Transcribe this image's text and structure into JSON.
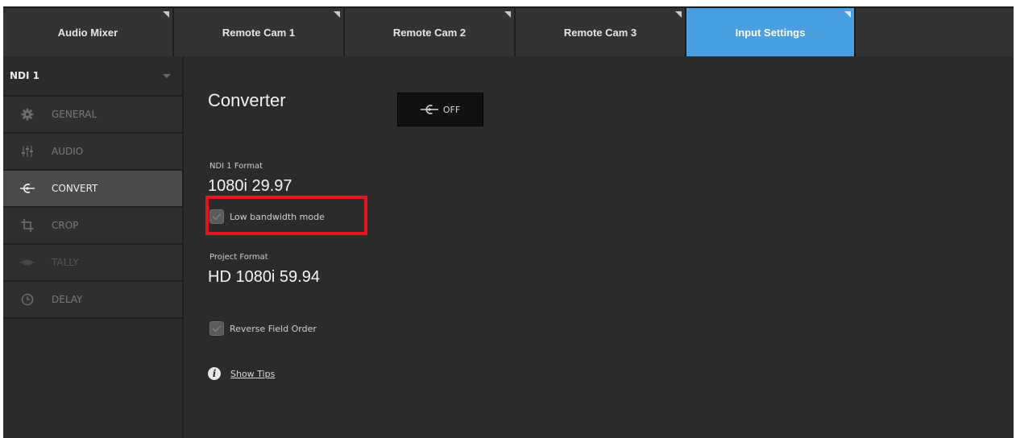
{
  "tabs": [
    {
      "label": "Audio Mixer"
    },
    {
      "label": "Remote Cam 1"
    },
    {
      "label": "Remote Cam 2"
    },
    {
      "label": "Remote Cam 3"
    },
    {
      "label": "Input Settings",
      "active": true
    }
  ],
  "sidebar": {
    "source": "NDI 1",
    "items": [
      {
        "label": "GENERAL",
        "icon": "gear-icon"
      },
      {
        "label": "AUDIO",
        "icon": "mixer-sliders-icon"
      },
      {
        "label": "CONVERT",
        "icon": "converter-icon",
        "active": true
      },
      {
        "label": "CROP",
        "icon": "crop-icon"
      },
      {
        "label": "TALLY",
        "icon": "tally-light-icon"
      },
      {
        "label": "DELAY",
        "icon": "clock-icon"
      }
    ]
  },
  "main": {
    "title": "Converter",
    "toggle_label": "OFF",
    "input_format_label": "NDI 1 Format",
    "input_format_value": "1080i 29.97",
    "low_bandwidth_label": "Low bandwidth mode",
    "low_bandwidth_checked": true,
    "project_format_label": "Project Format",
    "project_format_value": "HD 1080i 59.94",
    "reverse_field_label": "Reverse Field Order",
    "reverse_field_checked": true,
    "tips_label": "Show Tips"
  },
  "colors": {
    "accent": "#4a9fe0",
    "highlight": "#e8141b",
    "background": "#2b2b2b"
  }
}
